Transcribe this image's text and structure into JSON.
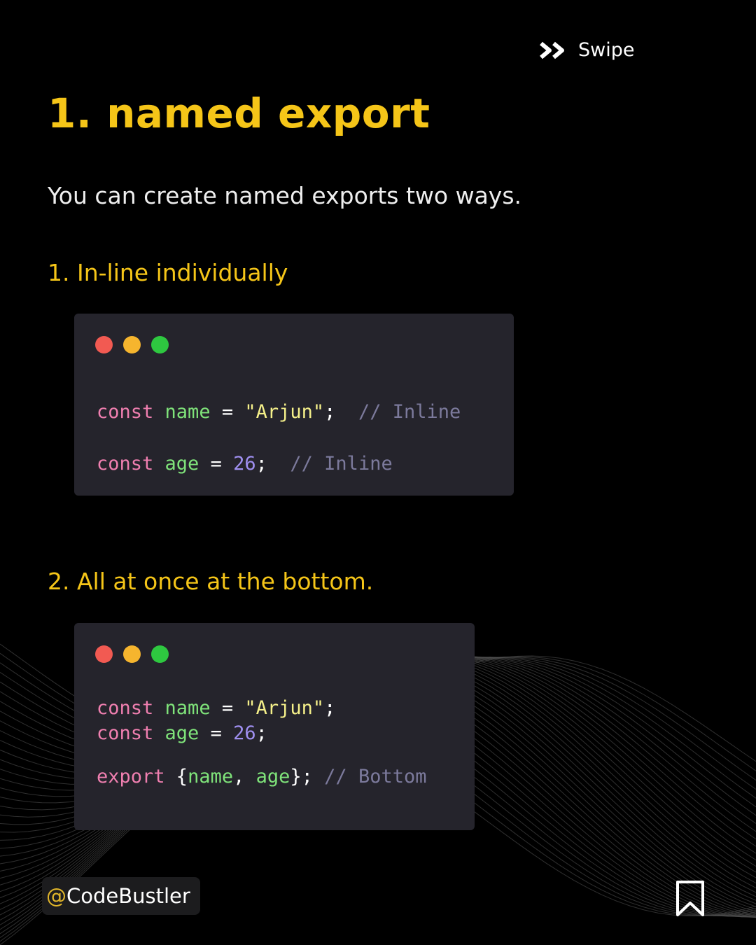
{
  "swipe": {
    "label": "Swipe",
    "icon": "double-chevron-right-icon"
  },
  "title": "1. named export",
  "subtitle": "You can create named exports two ways.",
  "section1": {
    "heading": "1. In-line individually",
    "lines": [
      [
        {
          "t": "const",
          "c": "k"
        },
        {
          "t": " "
        },
        {
          "t": "name",
          "c": "v"
        },
        {
          "t": " = "
        },
        {
          "t": "\"Arjun\"",
          "c": "s"
        },
        {
          "t": ";  "
        },
        {
          "t": "// Inline",
          "c": "c"
        }
      ],
      [
        {
          "t": "const",
          "c": "k"
        },
        {
          "t": " "
        },
        {
          "t": "age",
          "c": "v"
        },
        {
          "t": " = "
        },
        {
          "t": "26",
          "c": "n"
        },
        {
          "t": ";  "
        },
        {
          "t": "// Inline",
          "c": "c"
        }
      ]
    ]
  },
  "section2": {
    "heading": "2. All at once at the bottom.",
    "lines": [
      [
        {
          "t": "const",
          "c": "k"
        },
        {
          "t": " "
        },
        {
          "t": "name",
          "c": "v"
        },
        {
          "t": " = "
        },
        {
          "t": "\"Arjun\"",
          "c": "s"
        },
        {
          "t": ";"
        }
      ],
      [
        {
          "t": "const",
          "c": "k"
        },
        {
          "t": " "
        },
        {
          "t": "age",
          "c": "v"
        },
        {
          "t": " = "
        },
        {
          "t": "26",
          "c": "n"
        },
        {
          "t": ";"
        }
      ],
      [
        {
          "t": "export",
          "c": "k"
        },
        {
          "t": " {"
        },
        {
          "t": "name",
          "c": "v"
        },
        {
          "t": ", "
        },
        {
          "t": "age",
          "c": "v"
        },
        {
          "t": "}; "
        },
        {
          "t": "// Bottom",
          "c": "c"
        }
      ]
    ]
  },
  "window_dot_colors": [
    "#f25a52",
    "#f6b52e",
    "#2ec840"
  ],
  "accent": "#f5c518",
  "handle": {
    "at": "@",
    "name": "CodeBustler"
  },
  "bookmark_icon": "bookmark-icon"
}
